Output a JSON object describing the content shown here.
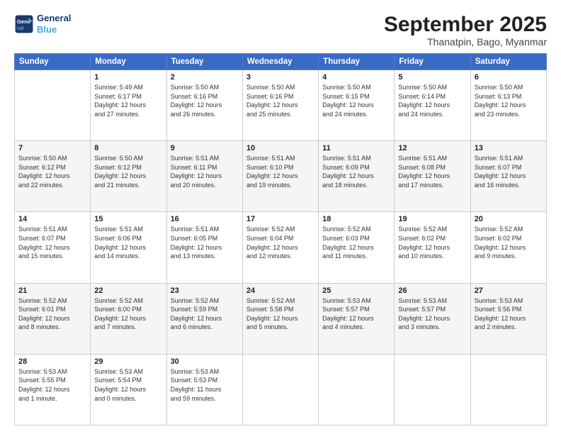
{
  "logo": {
    "line1": "General",
    "line2": "Blue"
  },
  "header": {
    "title": "September 2025",
    "subtitle": "Thanatpin, Bago, Myanmar"
  },
  "weekdays": [
    "Sunday",
    "Monday",
    "Tuesday",
    "Wednesday",
    "Thursday",
    "Friday",
    "Saturday"
  ],
  "weeks": [
    [
      {
        "day": "",
        "info": ""
      },
      {
        "day": "1",
        "info": "Sunrise: 5:49 AM\nSunset: 6:17 PM\nDaylight: 12 hours\nand 27 minutes."
      },
      {
        "day": "2",
        "info": "Sunrise: 5:50 AM\nSunset: 6:16 PM\nDaylight: 12 hours\nand 26 minutes."
      },
      {
        "day": "3",
        "info": "Sunrise: 5:50 AM\nSunset: 6:16 PM\nDaylight: 12 hours\nand 25 minutes."
      },
      {
        "day": "4",
        "info": "Sunrise: 5:50 AM\nSunset: 6:15 PM\nDaylight: 12 hours\nand 24 minutes."
      },
      {
        "day": "5",
        "info": "Sunrise: 5:50 AM\nSunset: 6:14 PM\nDaylight: 12 hours\nand 24 minutes."
      },
      {
        "day": "6",
        "info": "Sunrise: 5:50 AM\nSunset: 6:13 PM\nDaylight: 12 hours\nand 23 minutes."
      }
    ],
    [
      {
        "day": "7",
        "info": "Sunrise: 5:50 AM\nSunset: 6:12 PM\nDaylight: 12 hours\nand 22 minutes."
      },
      {
        "day": "8",
        "info": "Sunrise: 5:50 AM\nSunset: 6:12 PM\nDaylight: 12 hours\nand 21 minutes."
      },
      {
        "day": "9",
        "info": "Sunrise: 5:51 AM\nSunset: 6:11 PM\nDaylight: 12 hours\nand 20 minutes."
      },
      {
        "day": "10",
        "info": "Sunrise: 5:51 AM\nSunset: 6:10 PM\nDaylight: 12 hours\nand 19 minutes."
      },
      {
        "day": "11",
        "info": "Sunrise: 5:51 AM\nSunset: 6:09 PM\nDaylight: 12 hours\nand 18 minutes."
      },
      {
        "day": "12",
        "info": "Sunrise: 5:51 AM\nSunset: 6:08 PM\nDaylight: 12 hours\nand 17 minutes."
      },
      {
        "day": "13",
        "info": "Sunrise: 5:51 AM\nSunset: 6:07 PM\nDaylight: 12 hours\nand 16 minutes."
      }
    ],
    [
      {
        "day": "14",
        "info": "Sunrise: 5:51 AM\nSunset: 6:07 PM\nDaylight: 12 hours\nand 15 minutes."
      },
      {
        "day": "15",
        "info": "Sunrise: 5:51 AM\nSunset: 6:06 PM\nDaylight: 12 hours\nand 14 minutes."
      },
      {
        "day": "16",
        "info": "Sunrise: 5:51 AM\nSunset: 6:05 PM\nDaylight: 12 hours\nand 13 minutes."
      },
      {
        "day": "17",
        "info": "Sunrise: 5:52 AM\nSunset: 6:04 PM\nDaylight: 12 hours\nand 12 minutes."
      },
      {
        "day": "18",
        "info": "Sunrise: 5:52 AM\nSunset: 6:03 PM\nDaylight: 12 hours\nand 11 minutes."
      },
      {
        "day": "19",
        "info": "Sunrise: 5:52 AM\nSunset: 6:02 PM\nDaylight: 12 hours\nand 10 minutes."
      },
      {
        "day": "20",
        "info": "Sunrise: 5:52 AM\nSunset: 6:02 PM\nDaylight: 12 hours\nand 9 minutes."
      }
    ],
    [
      {
        "day": "21",
        "info": "Sunrise: 5:52 AM\nSunset: 6:01 PM\nDaylight: 12 hours\nand 8 minutes."
      },
      {
        "day": "22",
        "info": "Sunrise: 5:52 AM\nSunset: 6:00 PM\nDaylight: 12 hours\nand 7 minutes."
      },
      {
        "day": "23",
        "info": "Sunrise: 5:52 AM\nSunset: 5:59 PM\nDaylight: 12 hours\nand 6 minutes."
      },
      {
        "day": "24",
        "info": "Sunrise: 5:52 AM\nSunset: 5:58 PM\nDaylight: 12 hours\nand 5 minutes."
      },
      {
        "day": "25",
        "info": "Sunrise: 5:53 AM\nSunset: 5:57 PM\nDaylight: 12 hours\nand 4 minutes."
      },
      {
        "day": "26",
        "info": "Sunrise: 5:53 AM\nSunset: 5:57 PM\nDaylight: 12 hours\nand 3 minutes."
      },
      {
        "day": "27",
        "info": "Sunrise: 5:53 AM\nSunset: 5:56 PM\nDaylight: 12 hours\nand 2 minutes."
      }
    ],
    [
      {
        "day": "28",
        "info": "Sunrise: 5:53 AM\nSunset: 5:55 PM\nDaylight: 12 hours\nand 1 minute."
      },
      {
        "day": "29",
        "info": "Sunrise: 5:53 AM\nSunset: 5:54 PM\nDaylight: 12 hours\nand 0 minutes."
      },
      {
        "day": "30",
        "info": "Sunrise: 5:53 AM\nSunset: 5:53 PM\nDaylight: 11 hours\nand 59 minutes."
      },
      {
        "day": "",
        "info": ""
      },
      {
        "day": "",
        "info": ""
      },
      {
        "day": "",
        "info": ""
      },
      {
        "day": "",
        "info": ""
      }
    ]
  ]
}
